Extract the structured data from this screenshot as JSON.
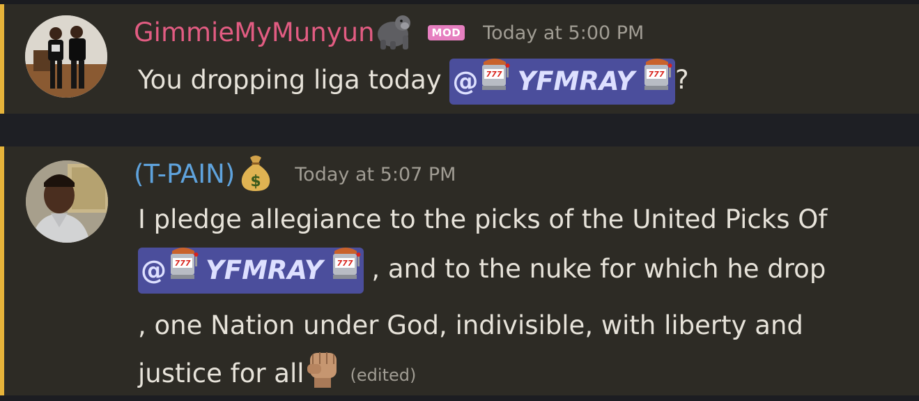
{
  "messages": [
    {
      "username": "GimmieMyMunyun",
      "username_emoji": "gorilla-emoji",
      "badge": "MOD",
      "timestamp": "Today at 5:00 PM",
      "content_before": "You dropping liga today ",
      "mention_at": "@",
      "mention_name": "YFMRAY",
      "content_after": "?"
    },
    {
      "username": "(T-PAIN)",
      "username_emoji": "money-bag-emoji",
      "timestamp": "Today at 5:07 PM",
      "line1": "I pledge allegiance to the picks of the United Picks Of",
      "mention_at": "@",
      "mention_name": "YFMRAY",
      "line2_after": " , and to the nuke for which  he drop",
      "line3": ", one Nation under God, indivisible, with liberty and",
      "line4": "justice for all",
      "line4_emoji": "raised-fist-emoji",
      "edited": "(edited)"
    }
  ],
  "colors": {
    "accent_bar": "#e6b33a",
    "username_1": "#e25c82",
    "username_2": "#5fa3dd",
    "mention_bg": "#4b4e9c",
    "mod_badge": "#e67fc0"
  }
}
